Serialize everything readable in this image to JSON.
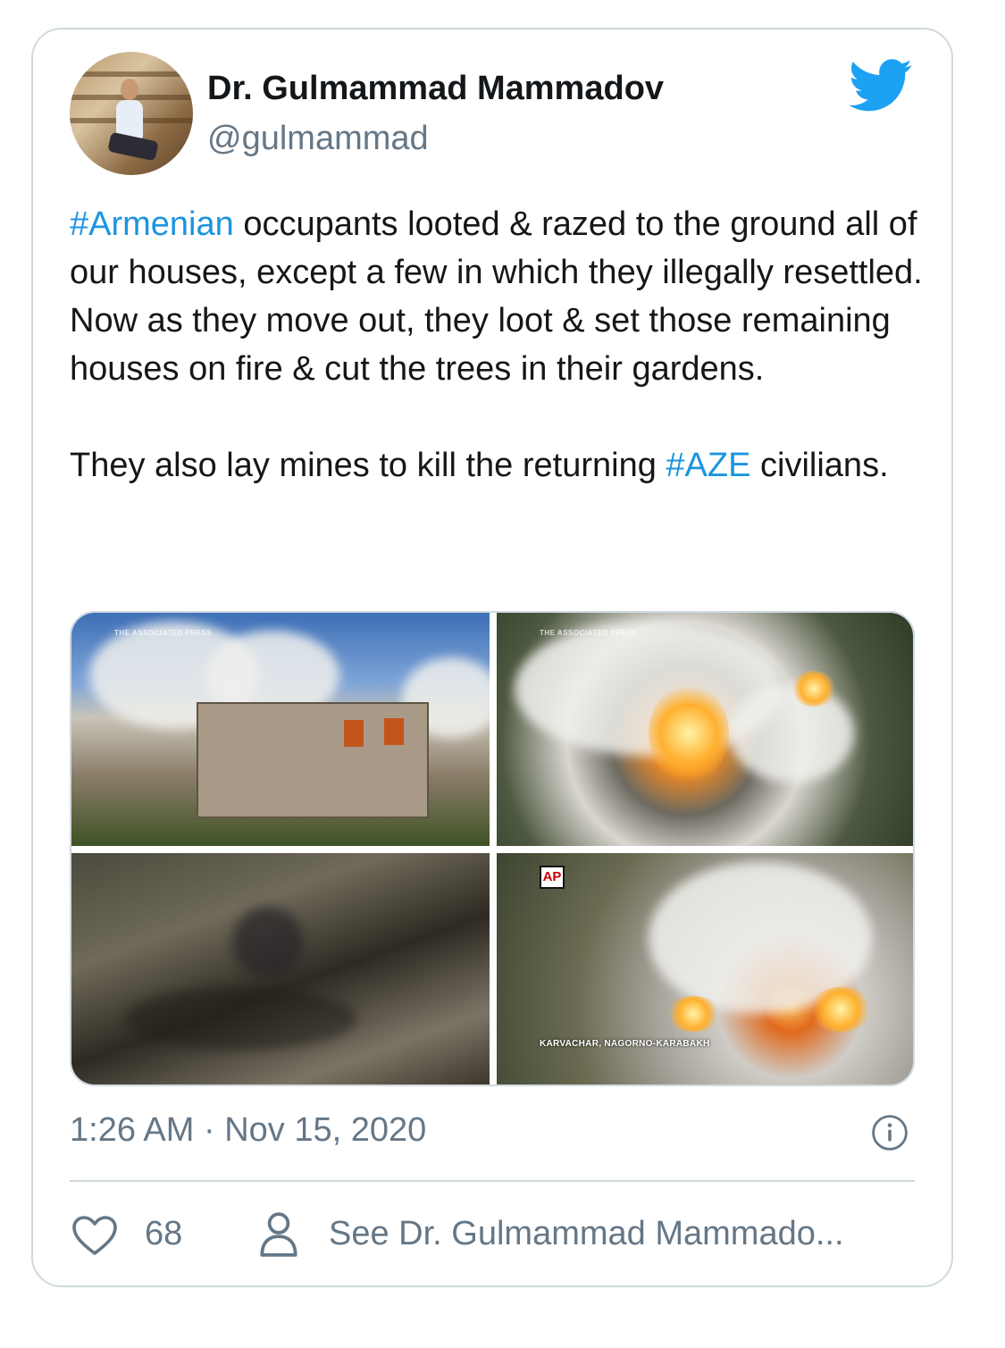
{
  "tweet": {
    "author": {
      "display_name": "Dr. Gulmammad Mammadov",
      "handle": "@gulmammad"
    },
    "text": {
      "hashtag_1": "#Armenian",
      "part_1": " occupants looted & razed to the ground all of our houses, except a few in which they illegally resettled. Now as they move out, they loot & set those remaining houses on fire & cut the trees in their gardens.\n\nThey also lay mines to kill the returning ",
      "hashtag_2": "#AZE",
      "part_2": " civilians."
    },
    "media": {
      "watermark_1": "THE ASSOCIATED PRESS",
      "watermark_2": "THE ASSOCIATED PRESS",
      "ap_logo": "AP",
      "caption_4": "KARVACHAR, NAGORNO-KARABAKH"
    },
    "timestamp": "1:26 AM · Nov 15, 2020",
    "actions": {
      "like_count": "68",
      "see_profile_label": "See Dr. Gulmammad Mammado..."
    },
    "icons": {
      "brand": "twitter-bird-icon",
      "info": "info-icon",
      "like": "heart-icon",
      "profile": "person-icon"
    },
    "colors": {
      "accent": "#1b95e0",
      "muted": "#657786",
      "border": "#cfd9de"
    }
  }
}
